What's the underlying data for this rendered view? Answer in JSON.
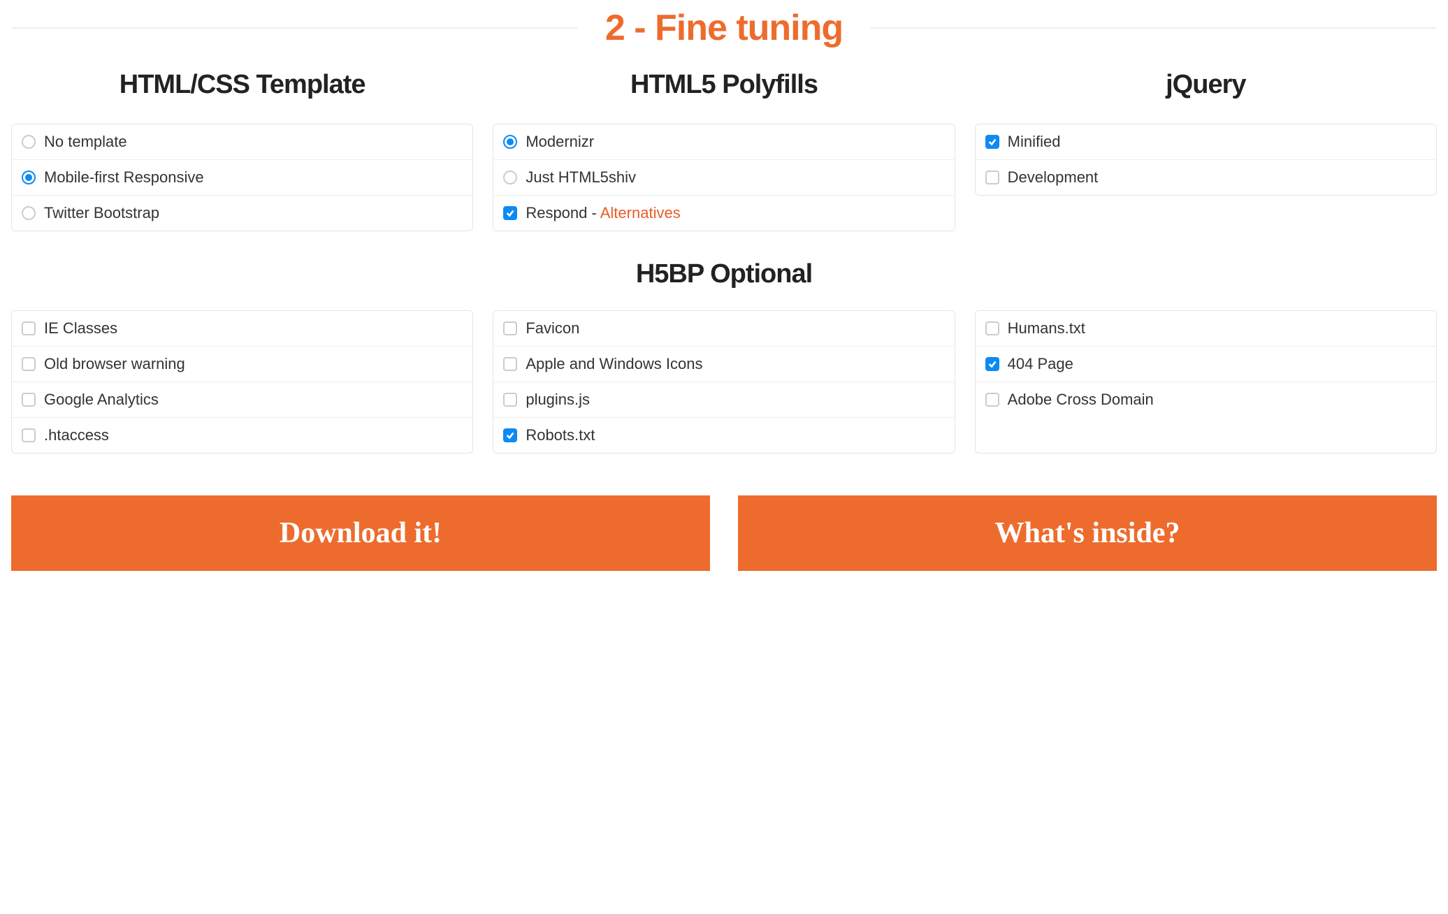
{
  "section_title": "2 - Fine tuning",
  "columns": {
    "template": {
      "title": "HTML/CSS Template",
      "options": [
        {
          "label": "No template",
          "type": "radio",
          "checked": false
        },
        {
          "label": "Mobile-first Responsive",
          "type": "radio",
          "checked": true
        },
        {
          "label": "Twitter Bootstrap",
          "type": "radio",
          "checked": false
        }
      ]
    },
    "polyfills": {
      "title": "HTML5 Polyfills",
      "options": [
        {
          "label": "Modernizr",
          "type": "radio",
          "checked": true
        },
        {
          "label": "Just HTML5shiv",
          "type": "radio",
          "checked": false
        },
        {
          "label": "Respond",
          "type": "checkbox",
          "checked": true,
          "extra_sep": " - ",
          "extra_link": "Alternatives"
        }
      ]
    },
    "jquery": {
      "title": "jQuery",
      "options": [
        {
          "label": "Minified",
          "type": "checkbox",
          "checked": true
        },
        {
          "label": "Development",
          "type": "checkbox",
          "checked": false
        }
      ]
    }
  },
  "h5bp": {
    "title": "H5BP Optional",
    "col1": [
      {
        "label": "IE Classes",
        "checked": false
      },
      {
        "label": "Old browser warning",
        "checked": false
      },
      {
        "label": "Google Analytics",
        "checked": false
      },
      {
        "label": ".htaccess",
        "checked": false
      }
    ],
    "col2": [
      {
        "label": "Favicon",
        "checked": false
      },
      {
        "label": "Apple and Windows Icons",
        "checked": false
      },
      {
        "label": "plugins.js",
        "checked": false
      },
      {
        "label": "Robots.txt",
        "checked": true
      }
    ],
    "col3": [
      {
        "label": "Humans.txt",
        "checked": false
      },
      {
        "label": "404 Page",
        "checked": true
      },
      {
        "label": "Adobe Cross Domain",
        "checked": false
      }
    ]
  },
  "actions": {
    "download": "Download it!",
    "inside": "What's inside?"
  }
}
